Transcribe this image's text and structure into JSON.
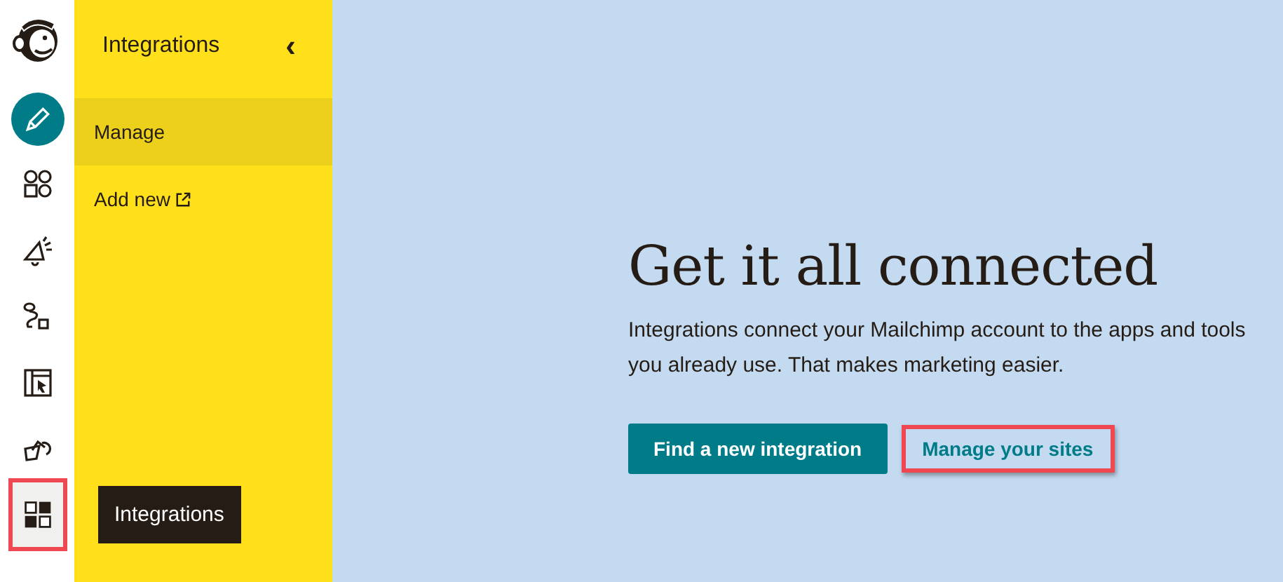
{
  "rail": {
    "items": [
      {
        "selected": true,
        "highlighted": false
      },
      {
        "selected": false,
        "highlighted": false
      },
      {
        "selected": false,
        "highlighted": false
      },
      {
        "selected": false,
        "highlighted": false
      },
      {
        "selected": false,
        "highlighted": false
      },
      {
        "selected": false,
        "highlighted": false
      },
      {
        "selected": false,
        "highlighted": true
      }
    ],
    "tooltip": "Integrations"
  },
  "panel": {
    "title": "Integrations",
    "collapse": "‹",
    "items": [
      {
        "label": "Manage",
        "selected": true,
        "external": false
      },
      {
        "label": "Add new",
        "selected": false,
        "external": true
      }
    ]
  },
  "main": {
    "heading": "Get it all connected",
    "text": "Integrations connect your Mailchimp account to the apps and tools you already use. That makes marketing easier.",
    "primary_button": "Find a new integration",
    "link": {
      "label": "Manage your sites",
      "highlighted": true
    }
  }
}
